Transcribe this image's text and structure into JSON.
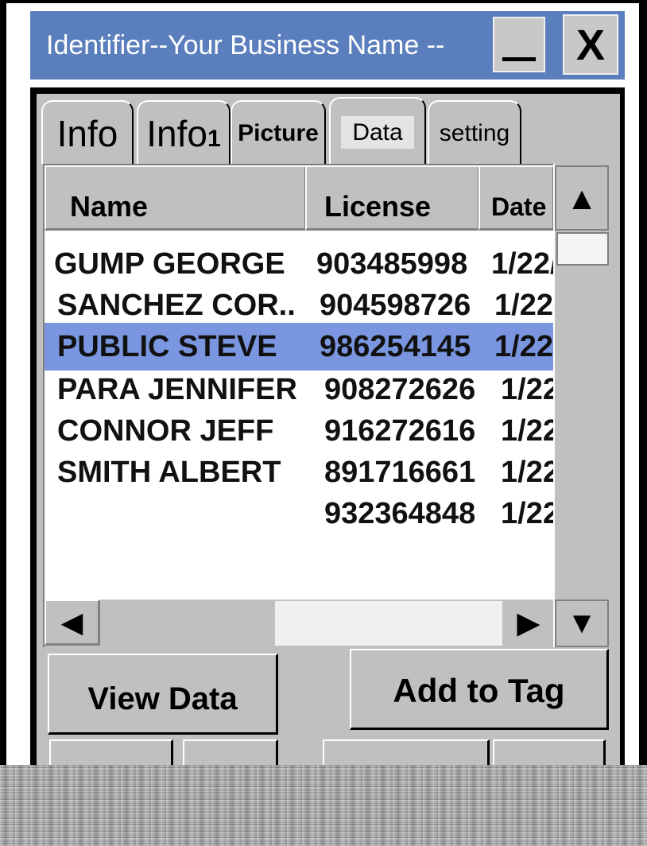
{
  "window": {
    "title": "Identifier--Your Business Name --",
    "minimize_glyph": "minimize",
    "close_label": "X"
  },
  "tabs": [
    {
      "label": "Info"
    },
    {
      "label": "Info1"
    },
    {
      "label": "Picture"
    },
    {
      "label": "Data",
      "active": true
    },
    {
      "label": "setting"
    }
  ],
  "list": {
    "columns": [
      "Name",
      "License",
      "Date"
    ],
    "rows": [
      {
        "name": "GUMP GEORGE",
        "license": "903485998",
        "date": "1/22/"
      },
      {
        "name": "SANCHEZ COR..",
        "license": "904598726",
        "date": "1/22"
      },
      {
        "name": "PUBLIC STEVE",
        "license": "986254145",
        "date": "1/22",
        "selected": true
      },
      {
        "name": "PARA JENNIFER",
        "license": "908272626",
        "date": "1/22"
      },
      {
        "name": "CONNOR JEFF",
        "license": "916272616",
        "date": "1/22"
      },
      {
        "name": "SMITH ALBERT",
        "license": "891716661",
        "date": "1/22"
      },
      {
        "name": "",
        "license": "932364848",
        "date": "1/22"
      }
    ]
  },
  "scroll": {
    "up_glyph": "▲",
    "down_glyph": "▼",
    "left_glyph": "◀",
    "right_glyph": "▶"
  },
  "buttons": {
    "view_data": "View Data",
    "add_to_tag": "Add to Tag"
  },
  "colors": {
    "titlebar": "#5b7fbd",
    "selection": "#7a96e0",
    "chrome": "#c0c0c0"
  }
}
